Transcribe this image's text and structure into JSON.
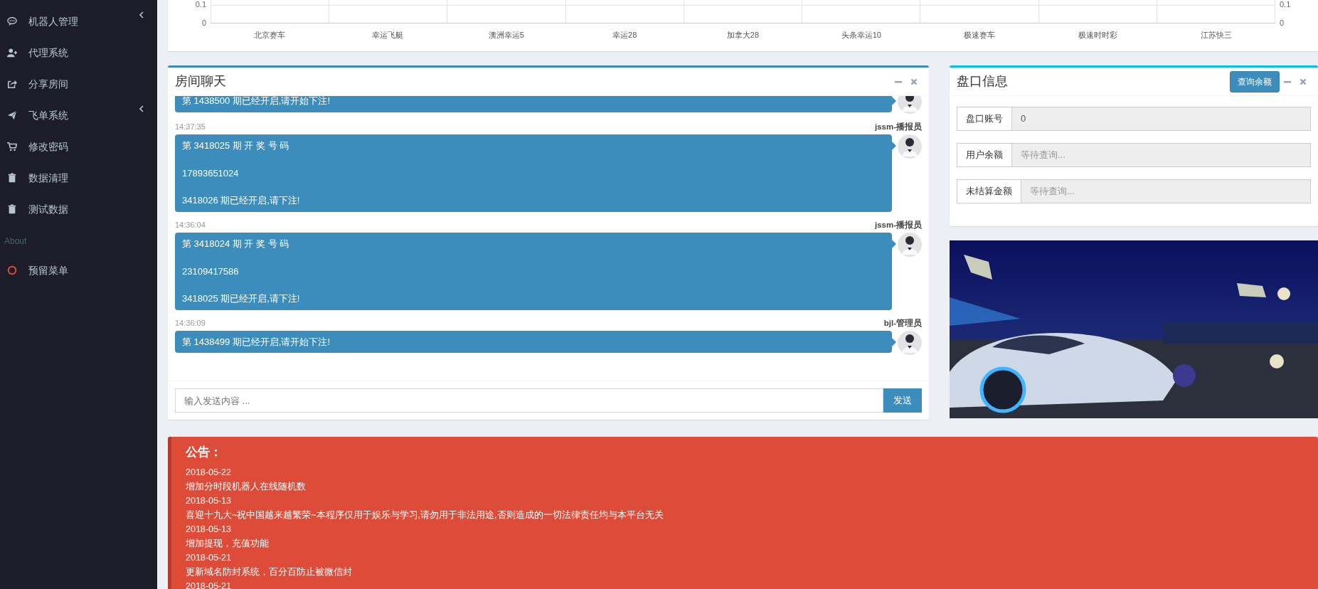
{
  "sidebar": {
    "items": [
      {
        "kind": "link",
        "label": "机器人管理",
        "expandable": true
      },
      {
        "kind": "link",
        "label": "代理系统",
        "expandable": false
      },
      {
        "kind": "link",
        "label": "分享房间",
        "expandable": false
      },
      {
        "kind": "link",
        "label": "飞单系统",
        "expandable": true
      },
      {
        "kind": "link",
        "label": "修改密码",
        "expandable": false
      },
      {
        "kind": "link",
        "label": "数据清理",
        "expandable": false
      },
      {
        "kind": "link",
        "label": "测试数据",
        "expandable": false
      },
      {
        "kind": "header",
        "label": "About"
      },
      {
        "kind": "link",
        "label": "预留菜单",
        "expandable": false
      }
    ]
  },
  "chart": {
    "left_ticks": [
      "0.1",
      "0"
    ],
    "right_ticks": [
      "0.1",
      "0"
    ],
    "categories": [
      "北京赛车",
      "幸运飞艇",
      "澳洲幸运5",
      "幸运28",
      "加拿大28",
      "头条幸运10",
      "极速赛车",
      "极速时时彩",
      "江苏快三"
    ]
  },
  "chat": {
    "title": "房间聊天",
    "messages": [
      {
        "lines": [
          "第 1438500 期已经开启,请开始下注!"
        ]
      },
      {
        "time": "14:37:35",
        "sender": "jssm-播报员",
        "lines": [
          "第 3418025 期 开 奖 号 码",
          "17893651024",
          "3418026 期已经开启,请下注!"
        ]
      },
      {
        "time": "14:36:04",
        "sender": "jssm-播报员",
        "lines": [
          "第 3418024 期 开 奖 号 码",
          "23109417586",
          "3418025 期已经开启,请下注!"
        ]
      },
      {
        "time": "14:36:09",
        "sender": "bjl-管理员",
        "lines": [
          "第 1438499 期已经开启,请开始下注!"
        ]
      }
    ],
    "input": {
      "placeholder": "输入发送内容 ..."
    },
    "send_button": "发送"
  },
  "account": {
    "title": "盘口信息",
    "query_button": "查询余额",
    "fields": [
      {
        "label": "盘口账号",
        "value": "0"
      },
      {
        "label": "用户余额",
        "placeholder": "等待查询..."
      },
      {
        "label": "未结算金额",
        "placeholder": "等待查询..."
      }
    ]
  },
  "notice": {
    "title": "公告：",
    "entries": [
      {
        "date": "2018-05-22",
        "text": "增加分时段机器人在线随机数"
      },
      {
        "date": "2018-05-13",
        "text": "喜迎十九大~祝中国越来越繁荣~本程序仅用于娱乐与学习,请勿用于非法用途,否则造成的一切法律责任均与本平台无关"
      },
      {
        "date": "2018-05-13",
        "text": "增加提现，充值功能"
      },
      {
        "date": "2018-05-21",
        "text": "更新域名防封系统，百分百防止被微信封"
      },
      {
        "date": "2018-05-21"
      }
    ]
  }
}
